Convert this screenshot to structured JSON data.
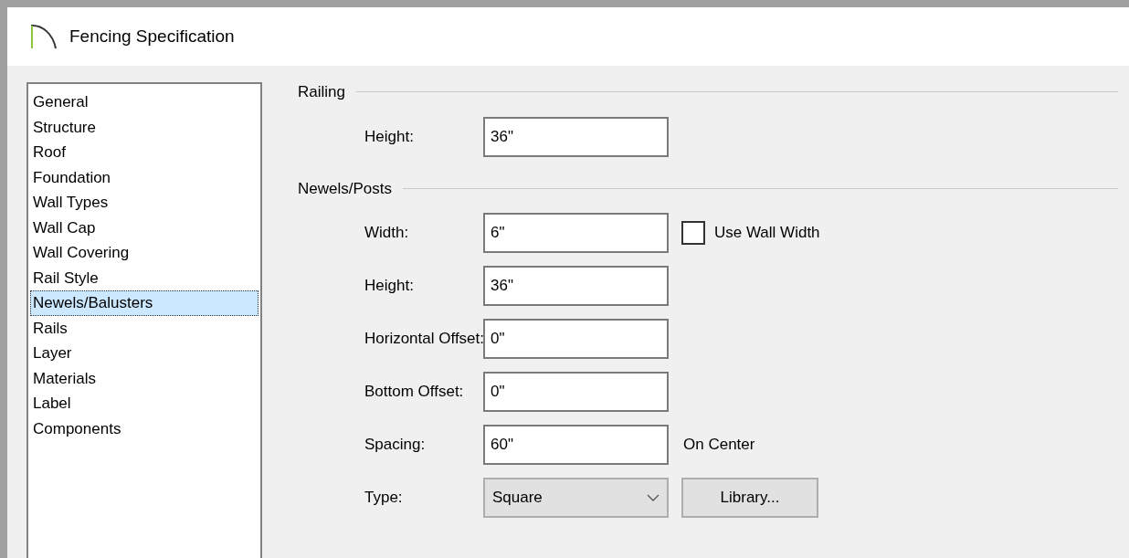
{
  "window": {
    "title": "Fencing Specification"
  },
  "sidebar": {
    "items": [
      {
        "label": "General",
        "selected": false
      },
      {
        "label": "Structure",
        "selected": false
      },
      {
        "label": "Roof",
        "selected": false
      },
      {
        "label": "Foundation",
        "selected": false
      },
      {
        "label": "Wall Types",
        "selected": false
      },
      {
        "label": "Wall Cap",
        "selected": false
      },
      {
        "label": "Wall Covering",
        "selected": false
      },
      {
        "label": "Rail Style",
        "selected": false
      },
      {
        "label": "Newels/Balusters",
        "selected": true
      },
      {
        "label": "Rails",
        "selected": false
      },
      {
        "label": "Layer",
        "selected": false
      },
      {
        "label": "Materials",
        "selected": false
      },
      {
        "label": "Label",
        "selected": false
      },
      {
        "label": "Components",
        "selected": false
      }
    ]
  },
  "sections": [
    {
      "title": "Railing",
      "rows": [
        {
          "kind": "text",
          "label": "Height:",
          "value": "36\""
        }
      ]
    },
    {
      "title": "Newels/Posts",
      "rows": [
        {
          "kind": "text",
          "label": "Width:",
          "value": "6\"",
          "checkbox": {
            "label": "Use Wall Width",
            "checked": false
          }
        },
        {
          "kind": "text",
          "label": "Height:",
          "value": "36\""
        },
        {
          "kind": "text",
          "label": "Horizontal Offset:",
          "value": "0\""
        },
        {
          "kind": "text",
          "label": "Bottom Offset:",
          "value": "0\""
        },
        {
          "kind": "text",
          "label": "Spacing:",
          "value": "60\"",
          "note": "On Center"
        },
        {
          "kind": "select",
          "label": "Type:",
          "value": "Square",
          "button": "Library..."
        }
      ]
    }
  ]
}
